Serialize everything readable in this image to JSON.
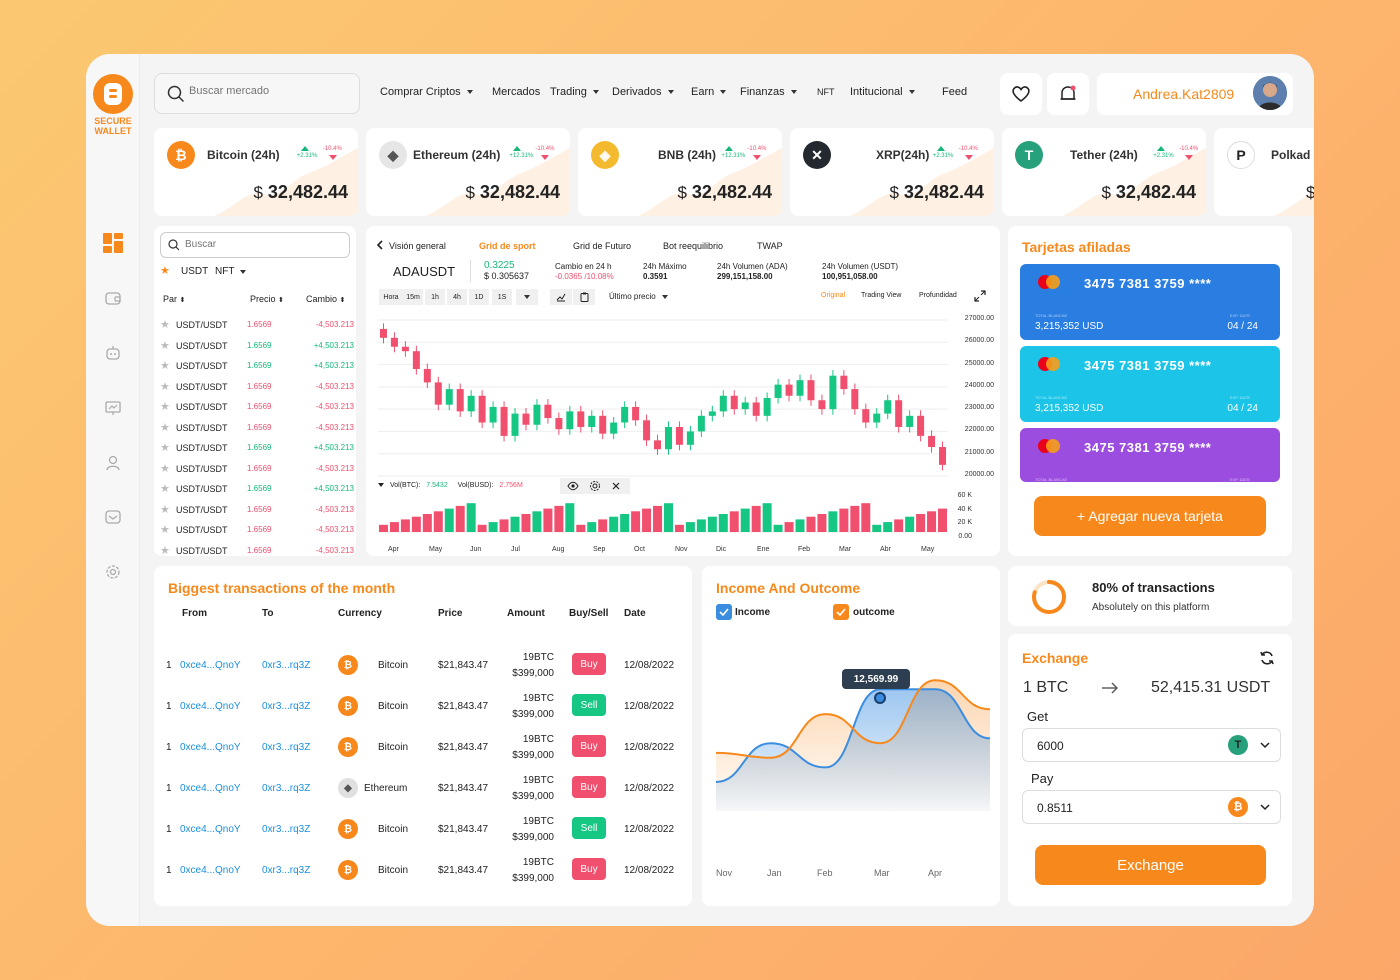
{
  "brand": {
    "name_line1": "SECURE",
    "name_line2": "WALLET"
  },
  "search": {
    "placeholder": "Buscar mercado"
  },
  "nav": [
    {
      "label": "Comprar Criptos",
      "caret": true
    },
    {
      "label": "Mercados",
      "caret": false
    },
    {
      "label": "Trading",
      "caret": true
    },
    {
      "label": "Derivados",
      "caret": true
    },
    {
      "label": "Earn",
      "caret": true
    },
    {
      "label": "Finanzas",
      "caret": true
    },
    {
      "label": "NFT",
      "caret": false
    },
    {
      "label": "Intitucional",
      "caret": true
    },
    {
      "label": "Feed",
      "caret": false
    }
  ],
  "user": {
    "name": "Andrea.Kat2809"
  },
  "tickers": [
    {
      "name": "Bitcoin (24h)",
      "up": "+2.31%",
      "down": "-10.4%",
      "price": "32,482.44",
      "currency": "$",
      "color": "#f7891c",
      "icon": "bitcoin-icon"
    },
    {
      "name": "Ethereum (24h)",
      "up": "+12.31%",
      "down": "-10.4%",
      "price": "32,482.44",
      "currency": "$",
      "color": "#8a8a8a",
      "icon": "ethereum-icon"
    },
    {
      "name": "BNB (24h)",
      "up": "+12.31%",
      "down": "-10.4%",
      "price": "32,482.44",
      "currency": "$",
      "color": "#f3ba2f",
      "icon": "bnb-icon"
    },
    {
      "name": "XRP(24h)",
      "up": "+2.31%",
      "down": "-10.4%",
      "price": "32,482.44",
      "currency": "$",
      "color": "#23292f",
      "icon": "xrp-icon"
    },
    {
      "name": "Tether (24h)",
      "up": "+2.31%",
      "down": "-10.4%",
      "price": "32,482.44",
      "currency": "$",
      "color": "#26a17b",
      "icon": "tether-icon"
    },
    {
      "name": "Polkad",
      "up": "",
      "down": "",
      "price": "",
      "currency": "$",
      "color": "#222222",
      "icon": "polkadot-icon"
    }
  ],
  "market": {
    "search_placeholder": "Buscar",
    "filter_tab1": "USDT",
    "filter_tab2": "NFT",
    "col_pair": "Par",
    "col_price": "Precio",
    "col_change": "Cambio",
    "rows": [
      {
        "pair": "USDT/USDT",
        "price": "1.6569",
        "change": "-4,503.213",
        "positive": false
      },
      {
        "pair": "USDT/USDT",
        "price": "1.6569",
        "change": "+4,503.213",
        "positive": true
      },
      {
        "pair": "USDT/USDT",
        "price": "1.6569",
        "change": "+4,503.213",
        "positive": true
      },
      {
        "pair": "USDT/USDT",
        "price": "1.6569",
        "change": "-4,503.213",
        "positive": false
      },
      {
        "pair": "USDT/USDT",
        "price": "1.6569",
        "change": "-4,503.213",
        "positive": false
      },
      {
        "pair": "USDT/USDT",
        "price": "1.6569",
        "change": "-4,503.213",
        "positive": false
      },
      {
        "pair": "USDT/USDT",
        "price": "1.6569",
        "change": "+4,503.213",
        "positive": true
      },
      {
        "pair": "USDT/USDT",
        "price": "1.6569",
        "change": "-4,503.213",
        "positive": false
      },
      {
        "pair": "USDT/USDT",
        "price": "1.6569",
        "change": "+4,503.213",
        "positive": true
      },
      {
        "pair": "USDT/USDT",
        "price": "1.6569",
        "change": "-4,503.213",
        "positive": false
      },
      {
        "pair": "USDT/USDT",
        "price": "1.6569",
        "change": "-4,503.213",
        "positive": false
      },
      {
        "pair": "USDT/USDT",
        "price": "1.6569",
        "change": "-4,503.213",
        "positive": false
      }
    ]
  },
  "chart_panel": {
    "tabs": [
      "Visión general",
      "Grid de sport",
      "Grid de Futuro",
      "Bot reequilibrio",
      "TWAP"
    ],
    "active_tab": "Grid de sport",
    "symbol": "ADAUSDT",
    "last_price": "0.3225",
    "last_price_usd": "$ 0.305637",
    "change_label": "Cambio en 24 h",
    "change_value": "-0.0365 /10.08%",
    "high_label": "24h Máximo",
    "high_value": "0.3591",
    "vol_ada_label": "24h Volumen (ADA)",
    "vol_ada_value": "299,151,158.00",
    "vol_usdt_label": "24h Volumen (USDT)",
    "vol_usdt_value": "100,951,058.00",
    "timeframes": [
      "Hora",
      "15m",
      "1h",
      "4h",
      "1D",
      "1S"
    ],
    "price_type": "Último precio",
    "view_modes": [
      "Original",
      "Trading View",
      "Profundidad"
    ],
    "active_view": "Original",
    "vol_btc_label": "Vol(BTC):",
    "vol_btc_value": "7.5432",
    "vol_busd_label": "Vol(BUSD):",
    "vol_busd_value": "2.756M"
  },
  "chart_data": [
    {
      "type": "candlestick",
      "title": "ADAUSDT",
      "x": [
        "Apr",
        "May",
        "Jun",
        "Jul",
        "Aug",
        "Sep",
        "Oct",
        "Nov",
        "Dic",
        "Ene",
        "Feb",
        "Mar",
        "Abr",
        "May"
      ],
      "yticks": [
        "27000.00",
        "26000.00",
        "25000.00",
        "24000.00",
        "23000.00",
        "22000.00",
        "21000.00",
        "20000.00"
      ],
      "ylim": [
        20000,
        27000
      ],
      "closes": [
        26200,
        25800,
        25600,
        24800,
        24200,
        23200,
        23900,
        22900,
        23600,
        22400,
        23100,
        21800,
        22800,
        22300,
        23200,
        22600,
        22100,
        22900,
        22200,
        22700,
        21900,
        22400,
        23100,
        22500,
        21600,
        21200,
        22200,
        21400,
        22000,
        22700,
        22900,
        23600,
        23000,
        23300,
        22700,
        23500,
        24100,
        23600,
        24300,
        23400,
        23000,
        24500,
        23900,
        23000,
        22400,
        22800,
        23400,
        22200,
        22700,
        21800,
        21300,
        20500
      ],
      "volume_yticks": [
        "60 K",
        "40 K",
        "20 K",
        "0.00"
      ],
      "volume_ylim": [
        0,
        60000
      ]
    },
    {
      "type": "area",
      "title": "Income And Outcome",
      "x": [
        "Nov",
        "Jan",
        "Feb",
        "Mar",
        "Apr"
      ],
      "series": [
        {
          "name": "Income",
          "color": "#3b8de0",
          "values": [
            3000,
            7000,
            4500,
            12569.99,
            12569.99,
            7500
          ]
        },
        {
          "name": "outcome",
          "color": "#f7891c",
          "values": [
            6000,
            5500,
            10000,
            7000,
            13500,
            10500
          ]
        }
      ],
      "tooltip": "12,569.99"
    }
  ],
  "cards": {
    "title": "Tarjetas afiladas",
    "items": [
      {
        "number": "3475 7381 3759 ****",
        "balance": "3,215,352 USD",
        "expiry": "04 / 24",
        "balance_label": "TOTAL BLANCAE",
        "expiry_label": "EXP. DATE",
        "color": "#2a7de1"
      },
      {
        "number": "3475 7381 3759 ****",
        "balance": "3,215,352 USD",
        "expiry": "04 / 24",
        "balance_label": "TOTAL BLANCAE",
        "expiry_label": "EXP. DATE",
        "color": "#1cc4e8"
      },
      {
        "number": "3475 7381 3759 ****",
        "balance": "",
        "expiry": "",
        "balance_label": "TOTAL BLANCAE",
        "expiry_label": "EXP. DATE",
        "color": "#9b4de0"
      }
    ],
    "add_button": "+ Agregar nueva tarjeta"
  },
  "transactions": {
    "title": "Biggest transactions of the month",
    "headers": [
      "From",
      "To",
      "Currency",
      "Price",
      "Amount",
      "Buy/Sell",
      "Date"
    ],
    "rows": [
      {
        "idx": "1",
        "from": "0xce4...QnoY",
        "to": "0xr3...rq3Z",
        "currency": "Bitcoin",
        "icon": "bitcoin-icon",
        "price": "$21,843.47",
        "amount1": "19BTC",
        "amount2": "$399,000",
        "action": "Buy",
        "date": "12/08/2022"
      },
      {
        "idx": "1",
        "from": "0xce4...QnoY",
        "to": "0xr3...rq3Z",
        "currency": "Bitcoin",
        "icon": "bitcoin-icon",
        "price": "$21,843.47",
        "amount1": "19BTC",
        "amount2": "$399,000",
        "action": "Sell",
        "date": "12/08/2022"
      },
      {
        "idx": "1",
        "from": "0xce4...QnoY",
        "to": "0xr3...rq3Z",
        "currency": "Bitcoin",
        "icon": "bitcoin-icon",
        "price": "$21,843.47",
        "amount1": "19BTC",
        "amount2": "$399,000",
        "action": "Buy",
        "date": "12/08/2022"
      },
      {
        "idx": "1",
        "from": "0xce4...QnoY",
        "to": "0xr3...rq3Z",
        "currency": "Ethereum",
        "icon": "ethereum-icon",
        "price": "$21,843.47",
        "amount1": "19BTC",
        "amount2": "$399,000",
        "action": "Buy",
        "date": "12/08/2022"
      },
      {
        "idx": "1",
        "from": "0xce4...QnoY",
        "to": "0xr3...rq3Z",
        "currency": "Bitcoin",
        "icon": "bitcoin-icon",
        "price": "$21,843.47",
        "amount1": "19BTC",
        "amount2": "$399,000",
        "action": "Sell",
        "date": "12/08/2022"
      },
      {
        "idx": "1",
        "from": "0xce4...QnoY",
        "to": "0xr3...rq3Z",
        "currency": "Bitcoin",
        "icon": "bitcoin-icon",
        "price": "$21,843.47",
        "amount1": "19BTC",
        "amount2": "$399,000",
        "action": "Buy",
        "date": "12/08/2022"
      }
    ]
  },
  "income": {
    "title": "Income And Outcome",
    "legend_income": "Income",
    "legend_outcome": "outcome",
    "tooltip": "12,569.99",
    "x_labels": [
      "Nov",
      "Jan",
      "Feb",
      "Mar",
      "Apr"
    ]
  },
  "stats": {
    "percent": 80,
    "title": "80% of transactions",
    "subtitle": "Absolutely on this platform"
  },
  "exchange": {
    "title": "Exchange",
    "from_amount": "1",
    "from_unit": "BTC",
    "to_amount": "52,415.31",
    "to_unit": "USDT",
    "get_label": "Get",
    "get_value": "6000",
    "pay_label": "Pay",
    "pay_value": "0.8511",
    "button": "Exchange"
  },
  "colors": {
    "accent": "#f7891c",
    "up": "#16b87a",
    "down": "#f0506e",
    "link": "#1a8fe0"
  }
}
